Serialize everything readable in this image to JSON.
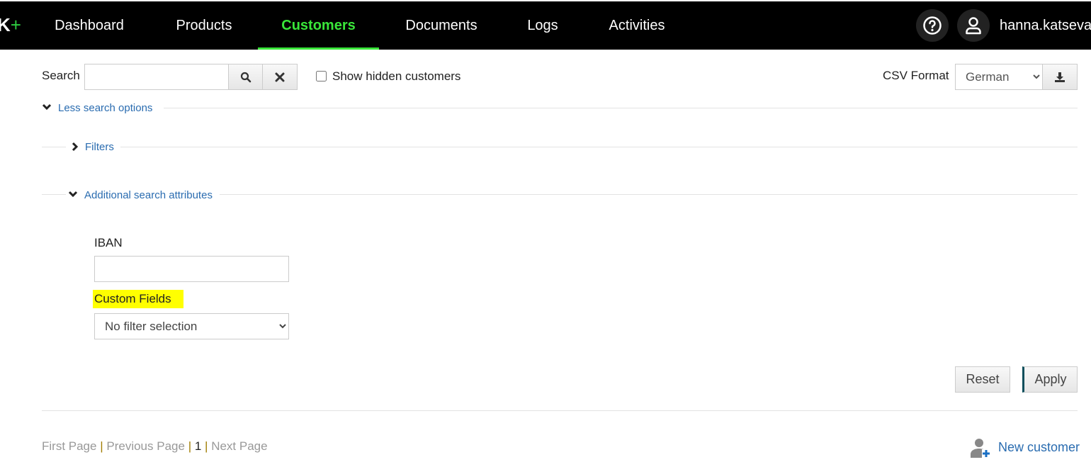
{
  "header": {
    "logo": "K",
    "logo_plus": "+",
    "nav": [
      {
        "label": "Dashboard"
      },
      {
        "label": "Products"
      },
      {
        "label": "Customers",
        "active": true
      },
      {
        "label": "Documents"
      },
      {
        "label": "Logs"
      },
      {
        "label": "Activities"
      }
    ],
    "username": "hanna.katseva",
    "accent": "#39e639"
  },
  "search": {
    "label": "Search",
    "value": "",
    "show_hidden_label": "Show hidden customers",
    "show_hidden_checked": false,
    "csv_label": "CSV Format",
    "csv_value": "German"
  },
  "options": {
    "less_label": "Less search options",
    "filters_label": "Filters",
    "additional_label": "Additional search attributes",
    "iban_label": "IBAN",
    "iban_value": "",
    "custom_fields_label": "Custom Fields",
    "custom_fields_value": "No filter selection",
    "reset_label": "Reset",
    "apply_label": "Apply"
  },
  "pager": {
    "first": "First Page",
    "previous": "Previous Page",
    "current": "1",
    "next": "Next Page",
    "separator": "|"
  },
  "new_customer_label": "New customer"
}
